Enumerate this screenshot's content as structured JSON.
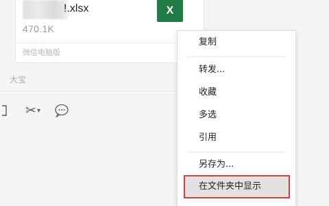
{
  "file_card": {
    "file_name": "!.xlsx",
    "file_size": "470.1K",
    "source": "微信电脑版",
    "excel_icon_letter": "X"
  },
  "sender_name": "大宝",
  "toolbar": {
    "icons": [
      "folder-icon",
      "scissors-icon",
      "chat-bubble-icon"
    ]
  },
  "context_menu": {
    "items": [
      {
        "label": "复制"
      },
      {
        "label": "转发..."
      },
      {
        "label": "收藏"
      },
      {
        "label": "多选"
      },
      {
        "label": "引用"
      },
      {
        "label": "另存为..."
      },
      {
        "label": "在文件夹中显示"
      }
    ],
    "highlight_color": "#e03b3b"
  },
  "colors": {
    "excel_green": "#1f7a43",
    "background": "#f5f5f5"
  }
}
